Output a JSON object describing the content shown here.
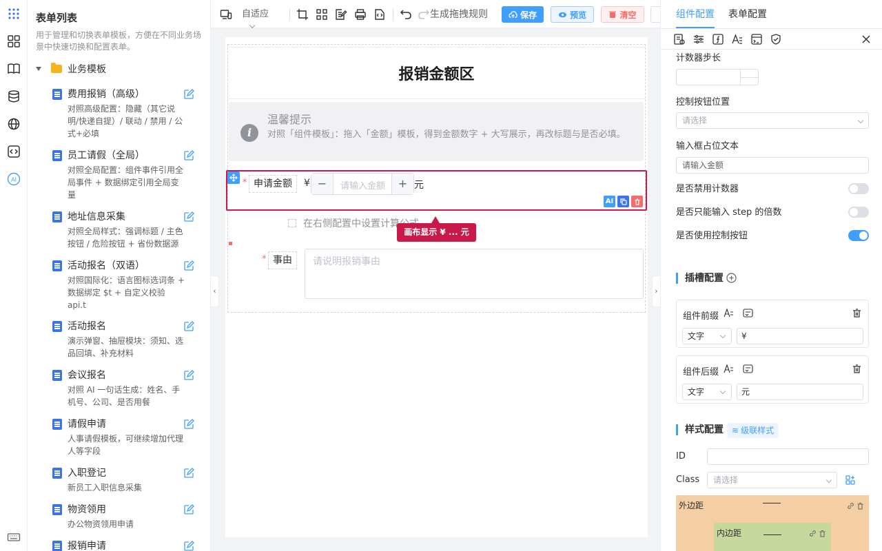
{
  "sidebar_rail": {
    "icons": [
      "apps-grid-icon",
      "widgets-icon",
      "book-icon",
      "database-icon",
      "globe-icon",
      "code-icon",
      "ai-icon",
      "keyboard-icon"
    ],
    "ai_label": "AI"
  },
  "template_panel": {
    "title": "表单列表",
    "description": "用于管理和切换表单模板，方便在不同业务场景中快速切换和配置表单。",
    "folder": "业务模板",
    "items": [
      {
        "name": "费用报销（高级）",
        "desc": "对照高级配置：隐藏（其它说明/快递自提）/ 联动 / 禁用 / 公式+必填"
      },
      {
        "name": "员工请假（全局）",
        "desc": "对照全局配置：组件事件引用全局事件 + 数据绑定引用全局变量"
      },
      {
        "name": "地址信息采集",
        "desc": "对照全局样式：强调标题 / 主色按钮 / 危险按钮 + 省份数据源"
      },
      {
        "name": "活动报名（双语）",
        "desc": "对照国际化：语言图标选词条 + 数据绑定 $t + 自定义校验 api.t"
      },
      {
        "name": "活动报名",
        "desc": "演示弹窗、抽屉模块：须知、选品回填、补充材料"
      },
      {
        "name": "会议报名",
        "desc": "对照 AI 一句话生成：姓名、手机号、公司、是否用餐"
      },
      {
        "name": "请假申请",
        "desc": "人事请假模板，可继续增加代理人等字段"
      },
      {
        "name": "入职登记",
        "desc": "新员工入职信息采集"
      },
      {
        "name": "物资领用",
        "desc": "办公物资领用申请"
      },
      {
        "name": "报销申请",
        "desc": ""
      }
    ]
  },
  "toolbar": {
    "layout_mode": "自适应",
    "generate_rules": "生成拖拽规则",
    "save": "保存",
    "preview": "预览",
    "clear": "清空"
  },
  "canvas": {
    "title": "报销金额区",
    "tip_title": "温馨提示",
    "tip_body": "对照「组件模板」：拖入「金额」模板，得到金额数字 + 大写展示，再改标题与是否必填。",
    "amount_label": "申请金额",
    "currency_prefix": "¥",
    "amount_placeholder": "请输入金额",
    "currency_suffix": "元",
    "minus": "−",
    "plus": "+",
    "formula_hint": "在右侧配置中设置计算公式",
    "callout": "画布显示 ¥ ... 元",
    "reason_label": "事由",
    "reason_placeholder": "请说明报销事由",
    "required_mark": "*",
    "action_ai": "AI"
  },
  "props": {
    "tabs": [
      "组件配置",
      "表单配置"
    ],
    "step_label": "计数器步长",
    "btn_pos_label": "控制按钮位置",
    "btn_pos_placeholder": "请选择",
    "placeholder_label": "输入框占位文本",
    "placeholder_value": "请输入金额",
    "disable_counter_label": "是否禁用计数器",
    "step_multiple_label": "是否只能输入 step 的倍数",
    "use_controls_label": "是否使用控制按钮",
    "switches": {
      "disable_counter": false,
      "step_multiple": false,
      "use_controls": true
    },
    "slot_title": "插槽配置",
    "prefix_title": "组件前缀",
    "prefix_type": "文字",
    "prefix_value": "¥",
    "suffix_title": "组件后缀",
    "suffix_type": "文字",
    "suffix_value": "元",
    "style_title": "样式配置",
    "cascade_tag": "级联样式",
    "id_label": "ID",
    "class_label": "Class",
    "class_placeholder": "请选择",
    "margin_label": "外边距",
    "padding_label": "内边距"
  },
  "colors": {
    "primary": "#409eff",
    "danger": "#f56c6c",
    "highlight": "#c8194a",
    "margin_box": "#f5cfa4",
    "padding_box": "#c8d79b"
  }
}
